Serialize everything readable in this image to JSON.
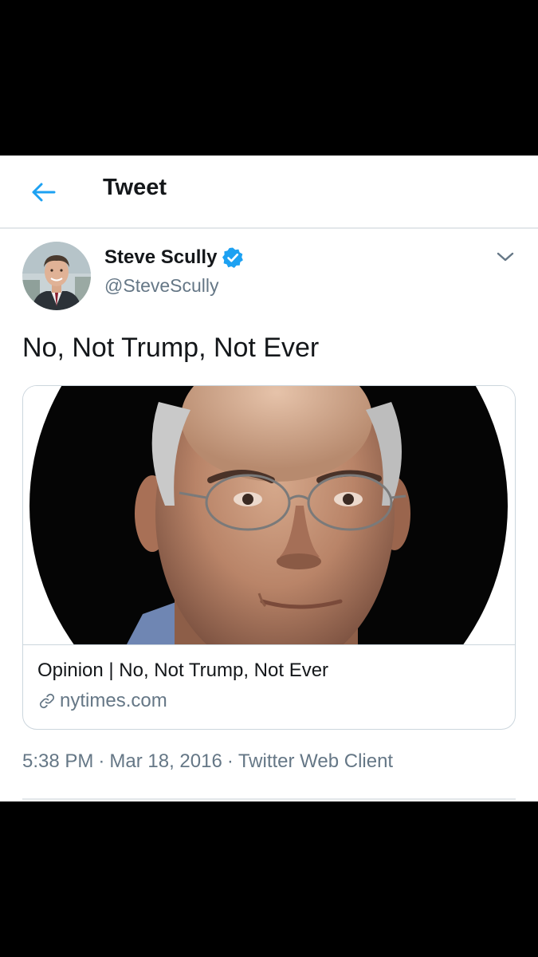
{
  "header": {
    "back_icon": "arrow-left-icon",
    "title": "Tweet"
  },
  "author": {
    "display_name": "Steve Scully",
    "handle": "@SteveScully",
    "verified": true,
    "verified_icon": "verified-badge-icon"
  },
  "tweet": {
    "text": "No, Not Trump, Not Ever",
    "menu_icon": "chevron-down-icon"
  },
  "card": {
    "title": "Opinion | No, Not Trump, Not Ever",
    "domain": "nytimes.com",
    "domain_icon": "link-icon"
  },
  "meta": {
    "time": "5:38 PM",
    "date": "Mar 18, 2016",
    "separator": "·",
    "source": "Twitter Web Client"
  },
  "colors": {
    "accent": "#1da1f2",
    "text_primary": "#14171a",
    "text_secondary": "#657786",
    "border": "#ccd6dd",
    "background": "#ffffff",
    "letterbox": "#000000"
  }
}
